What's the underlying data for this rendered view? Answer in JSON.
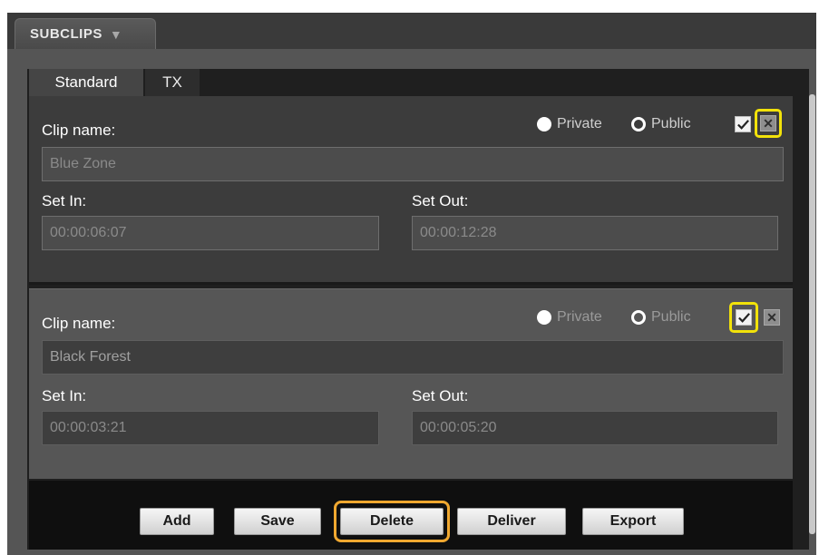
{
  "header": {
    "panel_title": "SUBCLIPS"
  },
  "tabs": [
    {
      "label": "Standard",
      "active": true
    },
    {
      "label": "TX",
      "active": false
    }
  ],
  "subclips": [
    {
      "clip_name_label": "Clip name:",
      "clip_name_value": "Blue Zone",
      "private_label": "Private",
      "public_label": "Public",
      "set_in_label": "Set In:",
      "set_in_value": "00:00:06:07",
      "set_out_label": "Set Out:",
      "set_out_value": "00:00:12:28",
      "checked": true,
      "highlight": "delete-box"
    },
    {
      "clip_name_label": "Clip name:",
      "clip_name_value": "Black Forest",
      "private_label": "Private",
      "public_label": "Public",
      "set_in_label": "Set In:",
      "set_in_value": "00:00:03:21",
      "set_out_label": "Set Out:",
      "set_out_value": "00:00:05:20",
      "checked": true,
      "highlight": "checkbox"
    }
  ],
  "footer": {
    "add_label": "Add",
    "save_label": "Save",
    "delete_label": "Delete",
    "deliver_label": "Deliver",
    "export_label": "Export"
  },
  "colors": {
    "highlight_yellow": "#f2e20a",
    "highlight_orange": "#f0a830",
    "panel_dark": "#1f1f1f"
  },
  "icons": [
    "chevron-down-icon",
    "radio-filled-icon",
    "radio-ring-icon",
    "checkmark-icon",
    "close-x-icon"
  ]
}
